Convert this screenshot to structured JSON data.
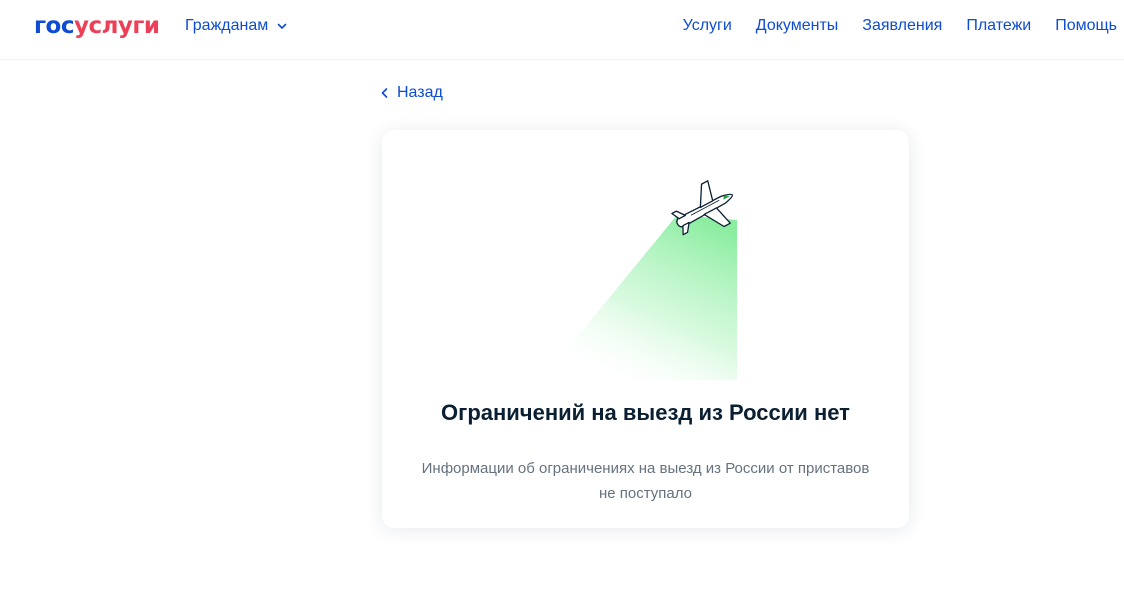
{
  "header": {
    "logo": {
      "part1": "гос",
      "part2": "услуги"
    },
    "citizens_label": "Гражданам",
    "nav": [
      "Услуги",
      "Документы",
      "Заявления",
      "Платежи",
      "Помощь"
    ]
  },
  "back_label": "Назад",
  "card": {
    "title": "Ограничений на выезд из России нет",
    "subtitle_line1": "Информации об ограничениях на выезд из России от приставов",
    "subtitle_line2": "не поступало"
  },
  "colors": {
    "brand_blue": "#0d4cd3",
    "brand_red": "#ee3f58",
    "text_dark": "#0b1f33",
    "text_muted": "#66727f",
    "beam_green": "#4be36b"
  },
  "icons": {
    "dropdown": "chevron-down-icon",
    "back": "chevron-left-icon",
    "illustration": "airplane-icon"
  }
}
